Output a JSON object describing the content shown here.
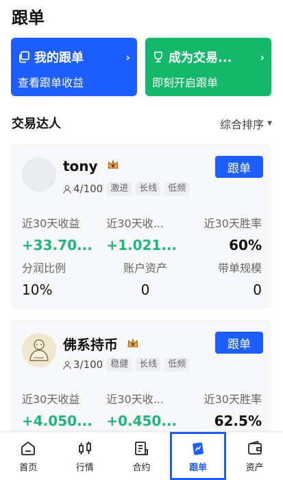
{
  "header": {
    "title": "跟单"
  },
  "banners": [
    {
      "title": "我的跟单",
      "subtitle": "查看跟单收益",
      "icon": "copy-icon",
      "color": "#1e5eff"
    },
    {
      "title": "成为交易...",
      "subtitle": "即刻开启跟单",
      "icon": "trophy-icon",
      "color": "#14b86b"
    }
  ],
  "section": {
    "title": "交易达人",
    "sort_label": "综合排序"
  },
  "traders": [
    {
      "name": "tony",
      "followers": "4/100",
      "tags": [
        "激进",
        "长线",
        "低频"
      ],
      "follow_label": "跟单",
      "stats_row1": [
        {
          "label": "近30天收益",
          "value": "+33.70..."
        },
        {
          "label": "近30天收...",
          "value": "+1.021..."
        },
        {
          "label": "近30天胜率",
          "value": "60%"
        }
      ],
      "stats_row2": [
        {
          "label": "分润比例",
          "value": "10%"
        },
        {
          "label": "账户资产",
          "value": "0"
        },
        {
          "label": "带单规模",
          "value": "0"
        }
      ]
    },
    {
      "name": "佛系持币",
      "followers": "3/100",
      "tags": [
        "稳健",
        "长线",
        "低频"
      ],
      "follow_label": "跟单",
      "stats_row1": [
        {
          "label": "近30天收益",
          "value": "+4.050..."
        },
        {
          "label": "近30天收...",
          "value": "+0.450..."
        },
        {
          "label": "近30天胜率",
          "value": "62.5%"
        }
      ]
    }
  ],
  "tabbar": [
    {
      "label": "首页",
      "icon": "home-icon"
    },
    {
      "label": "行情",
      "icon": "candlestick-icon"
    },
    {
      "label": "合约",
      "icon": "contract-icon"
    },
    {
      "label": "跟单",
      "icon": "copy-trade-icon",
      "active": true
    },
    {
      "label": "资产",
      "icon": "wallet-icon"
    }
  ],
  "colors": {
    "accent": "#1e5eff",
    "positive": "#1fb67a",
    "banner_green": "#14b86b"
  }
}
